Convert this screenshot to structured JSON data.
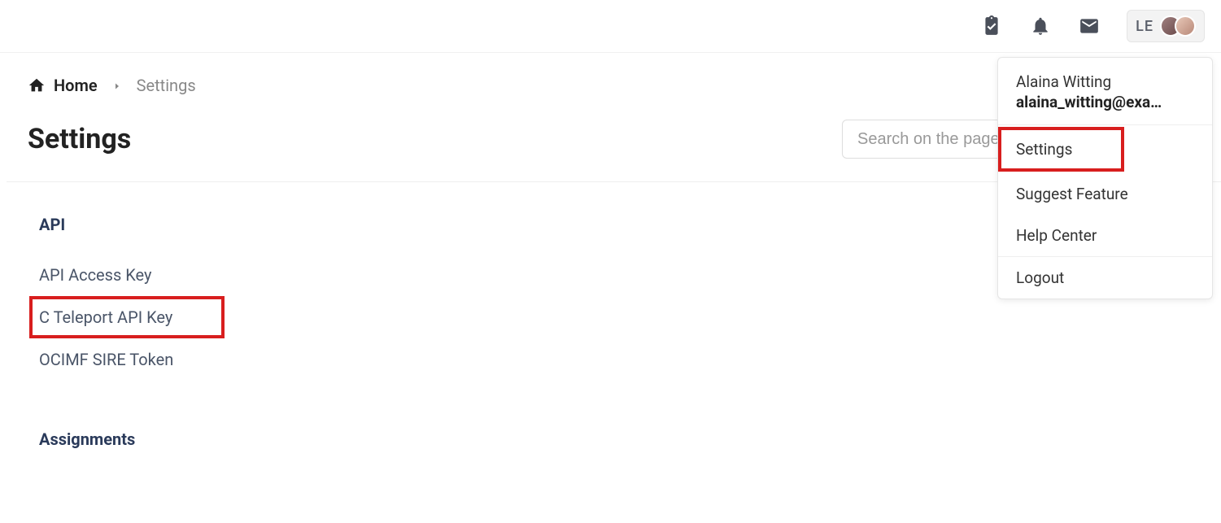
{
  "topbar": {
    "account_initials": "LE"
  },
  "breadcrumb": {
    "home_label": "Home",
    "current_label": "Settings"
  },
  "page": {
    "title": "Settings",
    "search_placeholder": "Search on the page"
  },
  "nav": {
    "section_api": "API",
    "api_items": [
      "API Access Key",
      "C Teleport API Key",
      "OCIMF SIRE Token"
    ],
    "section_assignments": "Assignments"
  },
  "dropdown": {
    "user_name": "Alaina Witting",
    "user_email": "alaina_witting@exa…",
    "items": {
      "settings": "Settings",
      "suggest_feature": "Suggest Feature",
      "help_center": "Help Center",
      "logout": "Logout"
    }
  }
}
